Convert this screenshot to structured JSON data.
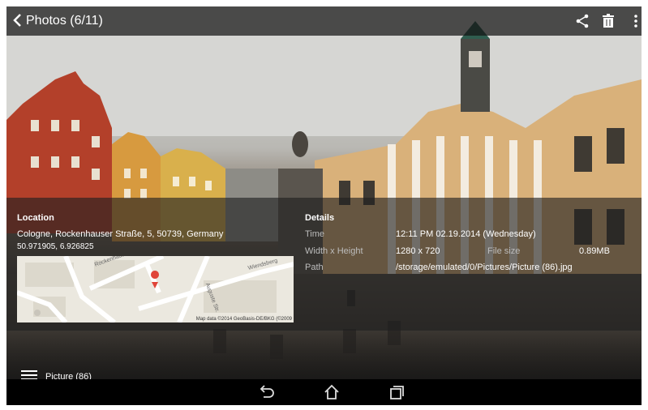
{
  "header": {
    "title": "Photos (6/11)",
    "back_icon": "chevron-left-icon",
    "share_icon": "share-icon",
    "delete_icon": "trash-icon",
    "menu_icon": "overflow-menu-icon"
  },
  "location": {
    "heading": "Location",
    "address": "Cologne, Rockenhauser Straße, 5, 50739, Germany",
    "coordinates": "50.971905, 6.926825",
    "map": {
      "street_1": "Rockenhauser",
      "street_2": "Wiendsberg",
      "street_3": "Auguste Str.",
      "credit": "Map data ©2014 GeoBasis-DE/BKG (©2009"
    }
  },
  "details": {
    "heading": "Details",
    "time_label": "Time",
    "time_value": "12:11 PM 02.19.2014 (Wednesday)",
    "dimensions_label": "Width x Height",
    "dimensions_value": "1280 x 720",
    "filesize_label": "File size",
    "filesize_value": "0.89MB",
    "path_label": "Path",
    "path_value": "/storage/emulated/0/Pictures/Picture (86).jpg"
  },
  "album": {
    "label": "Picture (86)",
    "icon": "album-stack-icon"
  },
  "navbar": {
    "back_icon": "nav-back-icon",
    "home_icon": "nav-home-icon",
    "recents_icon": "nav-recents-icon"
  }
}
